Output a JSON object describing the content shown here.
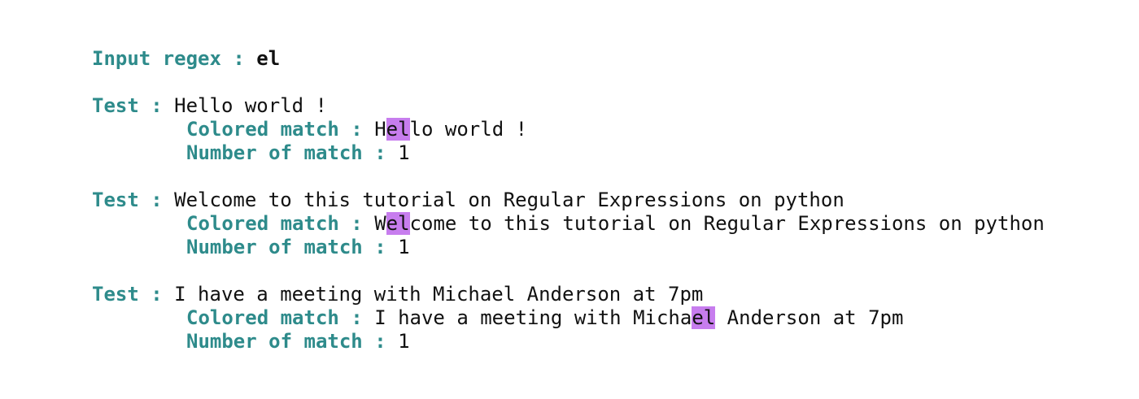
{
  "colors": {
    "label": "#2e8b8b",
    "text": "#111111",
    "highlight": "#c77dee",
    "background": "#ffffff"
  },
  "header": {
    "label": "Input regex : ",
    "value": "el"
  },
  "labels": {
    "test": "Test : ",
    "colored_match": "Colored match : ",
    "number_of_match": "Number of match : "
  },
  "tests": [
    {
      "text": "Hello world !",
      "match_before": "H",
      "match": "el",
      "match_after": "lo world !",
      "count": "1"
    },
    {
      "text": "Welcome to this tutorial on Regular Expressions on python",
      "match_before": "W",
      "match": "el",
      "match_after": "come to this tutorial on Regular Expressions on python",
      "count": "1"
    },
    {
      "text": "I have a meeting with Michael Anderson at 7pm",
      "match_before": "I have a meeting with Micha",
      "match": "el",
      "match_after": " Anderson at 7pm",
      "count": "1"
    }
  ]
}
